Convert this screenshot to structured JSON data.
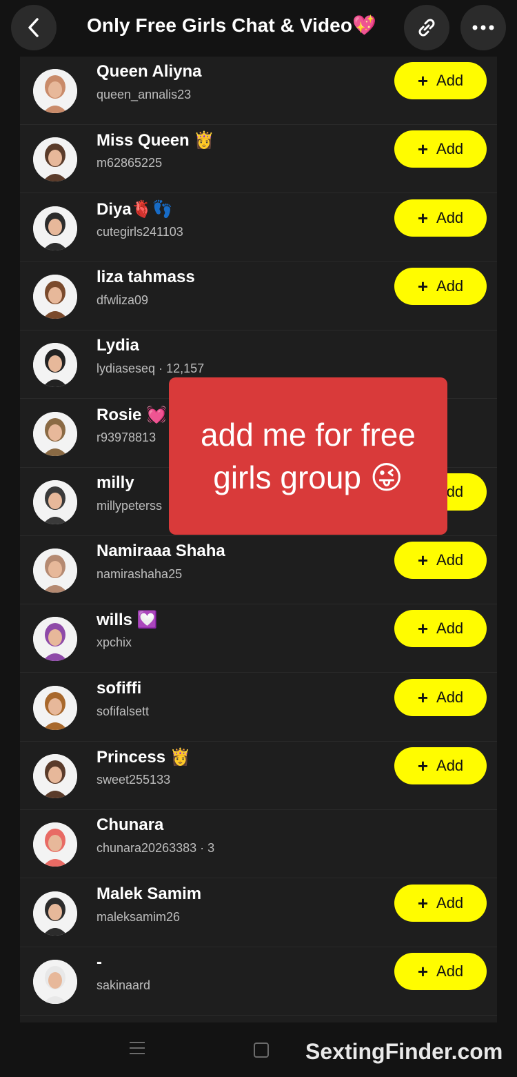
{
  "header": {
    "title": "Only Free Girls Chat & Video💖",
    "back_icon": "chevron-left-icon",
    "link_icon": "link-icon",
    "more_icon": "more-horizontal-icon"
  },
  "add_label": "Add",
  "accent_color": "#fffc00",
  "rows": [
    {
      "name": "Queen Aliyna",
      "username": "queen_annalis23",
      "meta": "",
      "has_add": true,
      "avatar_color": "#c98b6a"
    },
    {
      "name": "Miss Queen 👸",
      "username": "m62865225",
      "meta": "",
      "has_add": true,
      "avatar_color": "#5a3b2a"
    },
    {
      "name": "Diya🫀👣",
      "username": "cutegirls241103",
      "meta": "",
      "has_add": true,
      "avatar_color": "#2c2c2c"
    },
    {
      "name": "liza tahmass",
      "username": "dfwliza09",
      "meta": "",
      "has_add": true,
      "avatar_color": "#7a4a2c"
    },
    {
      "name": "Lydia",
      "username": "lydiaseseq",
      "meta": "12,157",
      "has_add": false,
      "avatar_color": "#222222"
    },
    {
      "name": "Rosie 💓",
      "username": "r93978813",
      "meta": "",
      "has_add": false,
      "avatar_color": "#8a6a44"
    },
    {
      "name": "milly",
      "username": "millypeterss",
      "meta": "",
      "has_add": true,
      "avatar_color": "#3a3a3a"
    },
    {
      "name": "Namiraaa Shaha",
      "username": "namirashaha25",
      "meta": "",
      "has_add": true,
      "avatar_color": "#b58a72"
    },
    {
      "name": "wills 💟",
      "username": "xpchix",
      "meta": "",
      "has_add": true,
      "avatar_color": "#8e4aa8"
    },
    {
      "name": "sofiffi",
      "username": "sofifalsett",
      "meta": "",
      "has_add": true,
      "avatar_color": "#a8682c"
    },
    {
      "name": "Princess 👸",
      "username": "sweet255133",
      "meta": "",
      "has_add": true,
      "avatar_color": "#5a3b2a"
    },
    {
      "name": "Chunara",
      "username": "chunara20263383",
      "meta": "3",
      "has_add": false,
      "avatar_color": "#e86a64"
    },
    {
      "name": "Malek Samim",
      "username": "maleksamim26",
      "meta": "",
      "has_add": true,
      "avatar_color": "#2c2c2c"
    },
    {
      "name": "-",
      "username": "sakinaard",
      "meta": "",
      "has_add": true,
      "avatar_color": "#e8e8e8"
    }
  ],
  "overlay": {
    "text": "add me for free girls group 😜"
  },
  "watermark": "SextingFinder.com",
  "bottom_nav": {
    "menu_icon": "menu-icon",
    "home_icon": "square-icon"
  }
}
